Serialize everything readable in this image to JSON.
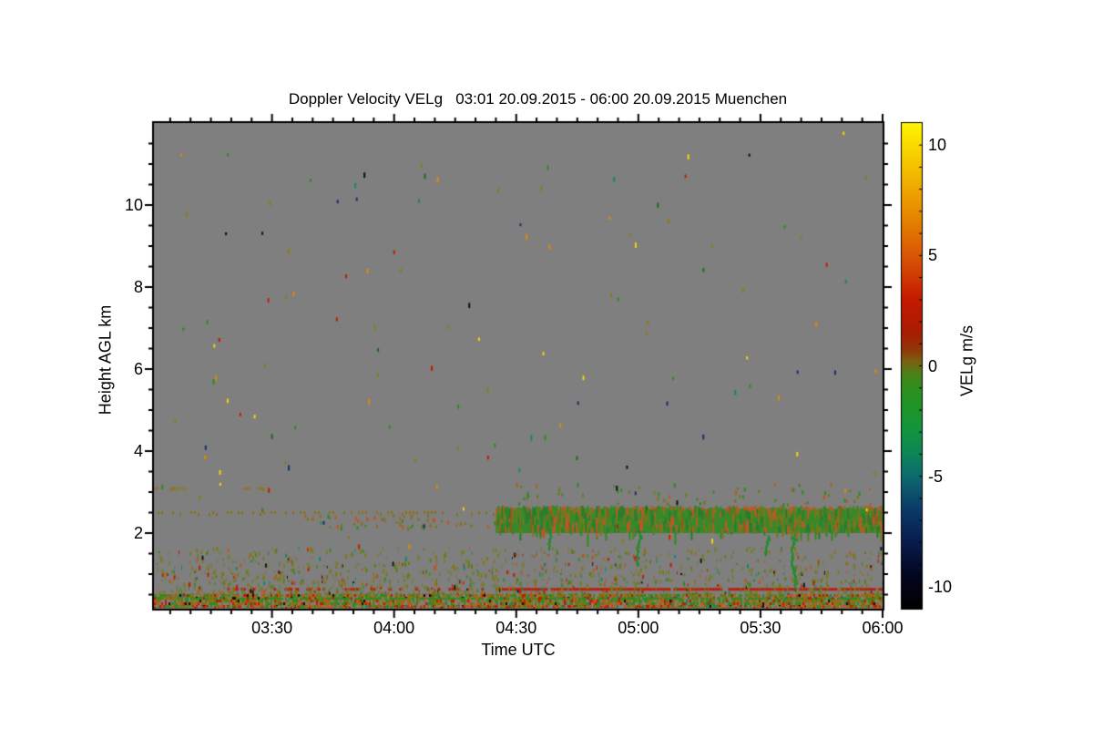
{
  "chart_data": {
    "type": "heatmap",
    "title": "Doppler Velocity VELg   03:01 20.09.2015 - 06:00 20.09.2015 Muenchen",
    "xlabel": "Time UTC",
    "ylabel": "Height AGL km",
    "time_start": "03:01",
    "time_end": "06:00",
    "duration_min": 179,
    "x_ticks": [
      {
        "label": "03:30",
        "t": 29
      },
      {
        "label": "04:00",
        "t": 59
      },
      {
        "label": "04:30",
        "t": 89
      },
      {
        "label": "05:00",
        "t": 119
      },
      {
        "label": "05:30",
        "t": 149
      },
      {
        "label": "06:00",
        "t": 179
      }
    ],
    "x_minor_step_min": 5,
    "y_ticks": [
      {
        "label": "2",
        "km": 2
      },
      {
        "label": "4",
        "km": 4
      },
      {
        "label": "6",
        "km": 6
      },
      {
        "label": "8",
        "km": 8
      },
      {
        "label": "10",
        "km": 10
      }
    ],
    "y_minor_step_km": 0.5,
    "y_top_km": 12,
    "plot_bg": "#7f7f7f",
    "axis_color": "#000000",
    "colorbar": {
      "label": "VELg m/s",
      "value_range": [
        -11,
        11
      ],
      "tick_labels": [
        {
          "label": "10",
          "v": 10
        },
        {
          "label": "5",
          "v": 5
        },
        {
          "label": "0",
          "v": 0
        },
        {
          "label": "-5",
          "v": -5
        },
        {
          "label": "-10",
          "v": -10
        }
      ],
      "minor_tick_step": 1,
      "gradient": [
        {
          "v": -11,
          "c": "#000000"
        },
        {
          "v": -9.5,
          "c": "#03071f"
        },
        {
          "v": -8,
          "c": "#081c4c"
        },
        {
          "v": -6.5,
          "c": "#0b3a6a"
        },
        {
          "v": -5,
          "c": "#0d6a6e"
        },
        {
          "v": -4,
          "c": "#0e8558"
        },
        {
          "v": -3,
          "c": "#129440"
        },
        {
          "v": -2,
          "c": "#1d9428"
        },
        {
          "v": -1,
          "c": "#2e8f1e"
        },
        {
          "v": -0.3,
          "c": "#4d7f16"
        },
        {
          "v": 0.2,
          "c": "#7c6012"
        },
        {
          "v": 0.7,
          "c": "#8f3a0a"
        },
        {
          "v": 1.5,
          "c": "#a81c02"
        },
        {
          "v": 3,
          "c": "#c41a00"
        },
        {
          "v": 5,
          "c": "#d95606"
        },
        {
          "v": 7,
          "c": "#e88d00"
        },
        {
          "v": 9,
          "c": "#f4c100"
        },
        {
          "v": 10.3,
          "c": "#fce300"
        },
        {
          "v": 11,
          "c": "#fff500"
        }
      ]
    },
    "features": [
      {
        "kind": "dotted_line",
        "name": "elevated-dotted-layer",
        "t": [
          0,
          84
        ],
        "km": 2.51,
        "density": 0.5,
        "colors": [
          "#8a6e10",
          "#97700c",
          "#7c7a12"
        ]
      },
      {
        "kind": "speckle_band",
        "name": "elevated-layer-undersprinkle",
        "t": [
          36,
          84
        ],
        "km": [
          2.15,
          2.48
        ],
        "density": 0.1,
        "colors": [
          "#6e7a10",
          "#2e8b1e",
          "#c2541a",
          "#8a6e10"
        ]
      },
      {
        "kind": "dense_band",
        "name": "cloud-base-band",
        "t": [
          84,
          179
        ],
        "km": [
          2.0,
          2.65
        ],
        "spike_km": 0.35,
        "palette": [
          [
            "#2e8b1e",
            0.4
          ],
          [
            "#1f7d24",
            0.18
          ],
          [
            "#6e7a10",
            0.26
          ],
          [
            "#c2541a",
            0.1
          ],
          [
            "#8a5a0e",
            0.06
          ]
        ]
      },
      {
        "kind": "speckle_band",
        "name": "above-band-sprinkle",
        "t": [
          84,
          179
        ],
        "km": [
          2.72,
          3.25
        ],
        "density": 0.035,
        "colors": [
          "#2e8b1e",
          "#6e7a10",
          "#c2541a"
        ]
      },
      {
        "kind": "streaks",
        "name": "virga-streaks",
        "color": "#1f8c28",
        "items": [
          {
            "t": 97,
            "km": [
              1.62,
              2.0
            ]
          },
          {
            "t": 119,
            "km": [
              1.22,
              2.0
            ]
          },
          {
            "t": 150.5,
            "km": [
              1.5,
              1.95
            ]
          },
          {
            "t": 157,
            "km": [
              0.58,
              2.0
            ]
          }
        ]
      },
      {
        "kind": "dash_row",
        "name": "three-km-dashes",
        "km": 3.09,
        "segments_t": [
          [
            0,
            1
          ],
          [
            4,
            8.5
          ],
          [
            22,
            28.5
          ]
        ],
        "colors": [
          "#8a7d12",
          "#96700c"
        ]
      },
      {
        "kind": "dots",
        "name": "isolated-marked-dots",
        "items": [
          {
            "t": 16,
            "km": 3.49,
            "c": "#f2d800"
          },
          {
            "t": 28,
            "km": 3.05,
            "c": "#c41a00"
          }
        ]
      },
      {
        "kind": "red_line",
        "name": "half-km-red-line",
        "km": 0.64,
        "t_spotty": [
          18,
          84
        ],
        "t_solid": [
          84,
          179
        ],
        "color": "#c0180a"
      },
      {
        "kind": "low_speckle",
        "name": "boundary-layer-speckle",
        "t": [
          0,
          179
        ],
        "km": [
          0.52,
          1.67
        ],
        "count": 1300,
        "palette": [
          [
            "#7d7a14",
            0.5
          ],
          [
            "#5d7d10",
            0.2
          ],
          [
            "#c2541a",
            0.1
          ],
          [
            "#c41a00",
            0.08
          ],
          [
            "#0e8a6a",
            0.05
          ],
          [
            "#2e8b1e",
            0.04
          ],
          [
            "#141414",
            0.03
          ]
        ]
      },
      {
        "kind": "ground_band",
        "name": "surface-band",
        "t": [
          0,
          179
        ],
        "km": [
          0.16,
          0.51
        ],
        "green_row_km": 0.42,
        "green_row_color": "#2e8b1e",
        "palette": [
          [
            "#7d7a14",
            0.28
          ],
          [
            "#2e8b1e",
            0.2
          ],
          [
            "#c2541a",
            0.2
          ],
          [
            "#c41a00",
            0.14
          ],
          [
            "#5d7d10",
            0.1
          ],
          [
            "#0e8a6a",
            0.05
          ],
          [
            "#101010",
            0.03
          ]
        ],
        "bottom_palette": [
          [
            "#c2541a",
            0.4
          ],
          [
            "#c41a00",
            0.3
          ],
          [
            "#7d7a14",
            0.2
          ],
          [
            "#2e8b1e",
            0.1
          ]
        ]
      }
    ],
    "noise": {
      "name": "free-atmosphere-speckle",
      "count": 135,
      "t": [
        0.5,
        178.5
      ],
      "km": [
        1.7,
        11.9
      ],
      "palette": [
        [
          "#8a7d12",
          0.26
        ],
        [
          "#2e8b1e",
          0.13
        ],
        [
          "#0e8a6a",
          0.11
        ],
        [
          "#e08a00",
          0.12
        ],
        [
          "#c41a00",
          0.1
        ],
        [
          "#f2d800",
          0.09
        ],
        [
          "#0d0d0d",
          0.09
        ],
        [
          "#12306e",
          0.05
        ],
        [
          "#1a6e14",
          0.05
        ]
      ]
    }
  }
}
